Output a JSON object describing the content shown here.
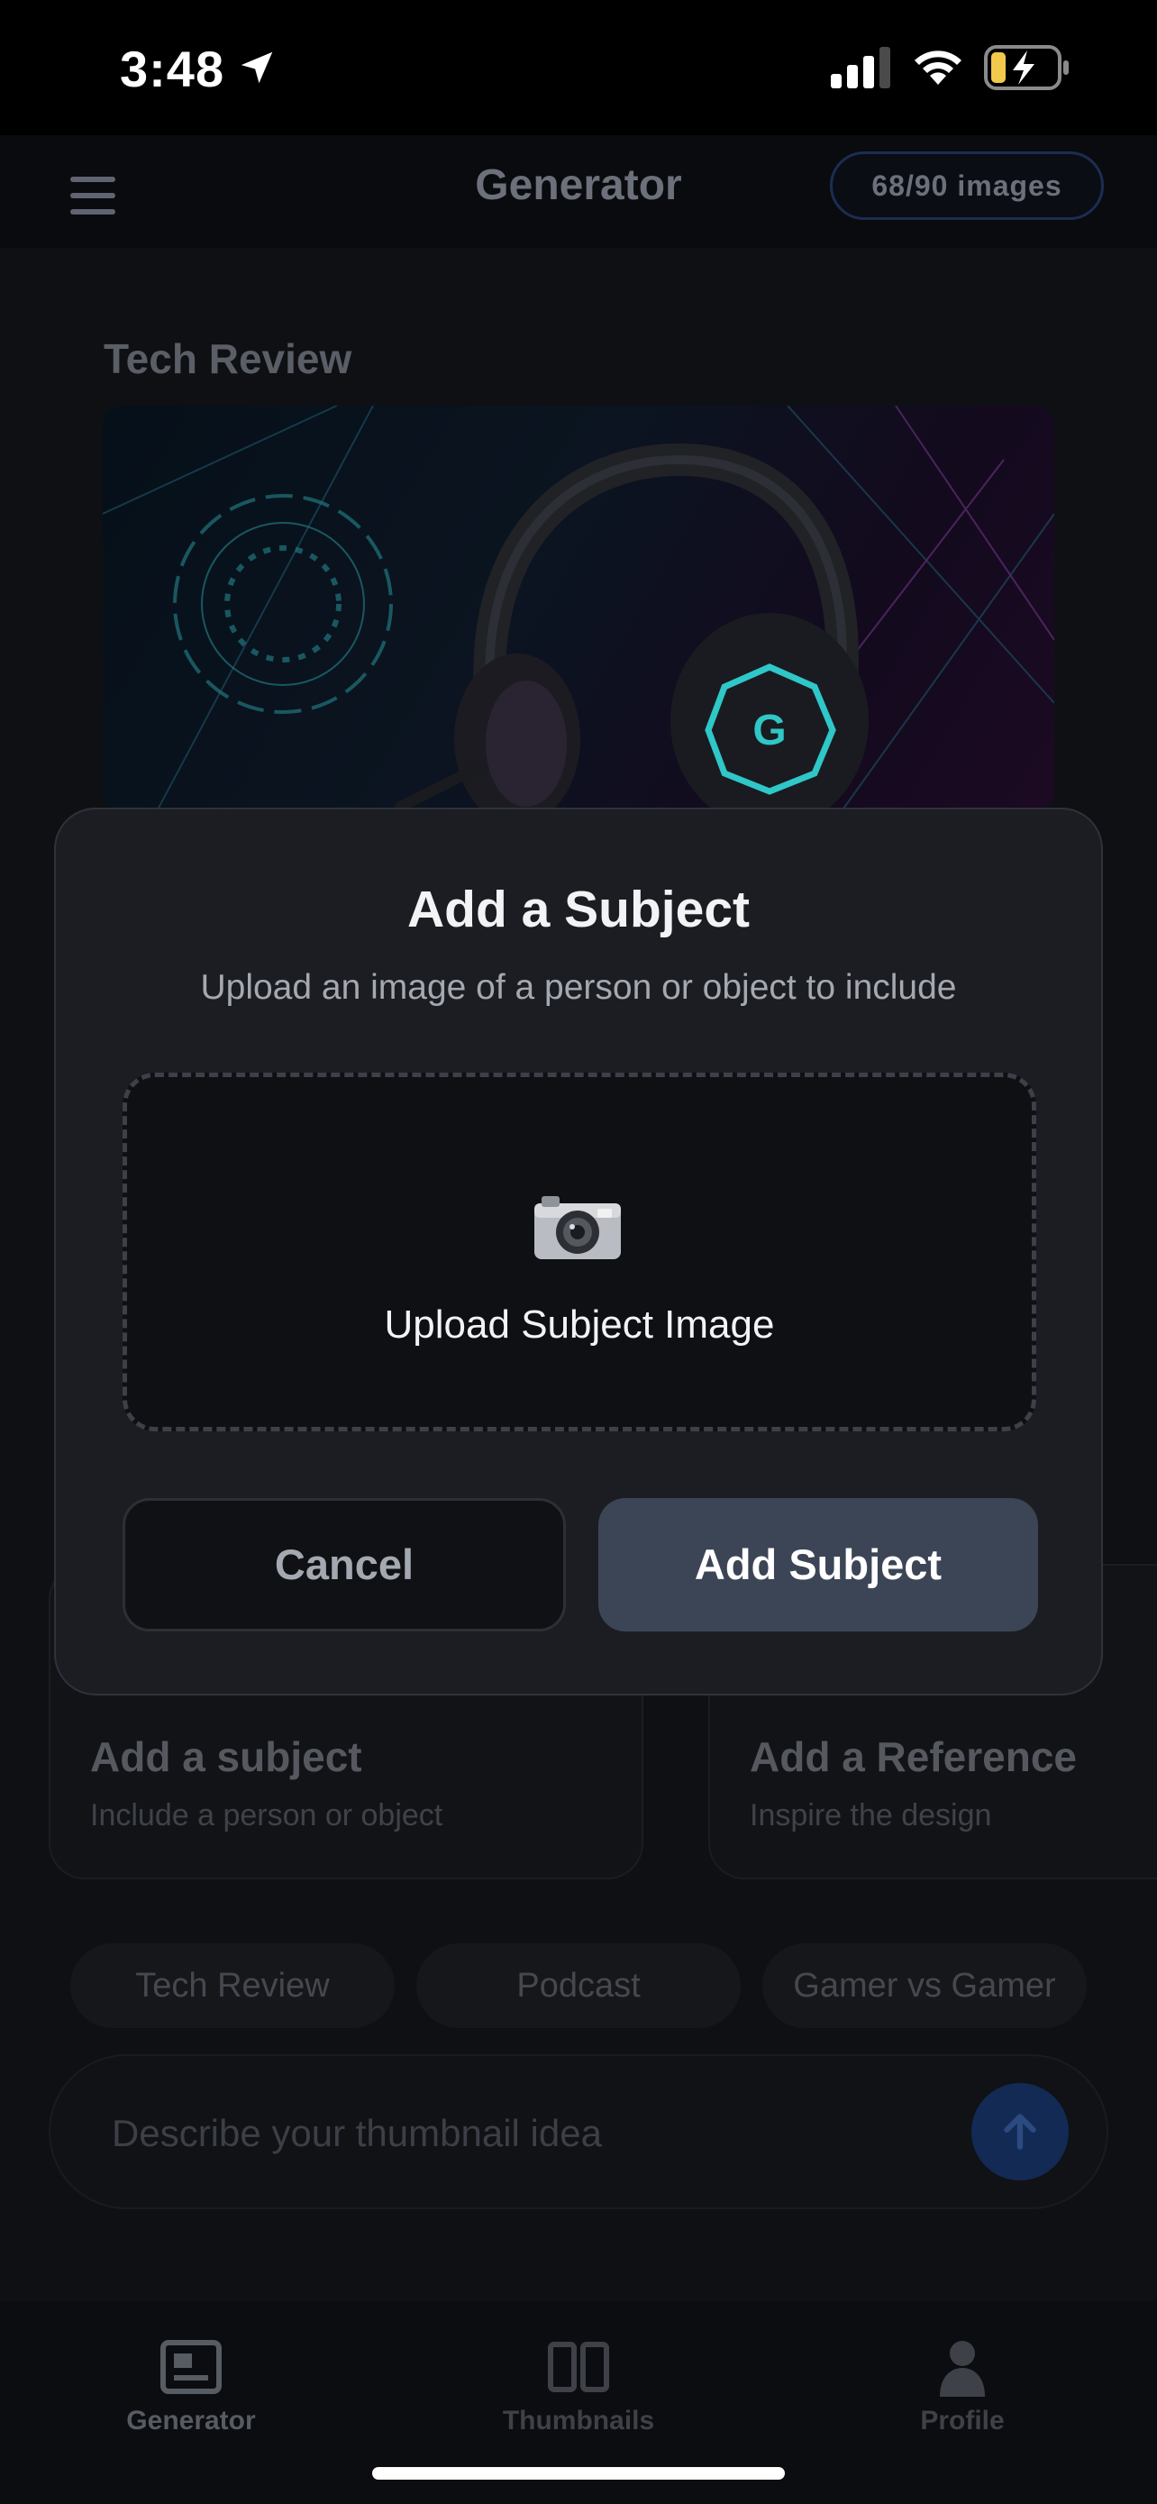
{
  "status_bar": {
    "time": "3:48"
  },
  "header": {
    "title": "Generator",
    "quota": "68/90 images"
  },
  "main": {
    "template_title": "Tech Review",
    "options": [
      {
        "title": "Add a subject",
        "subtitle": "Include a person or object"
      },
      {
        "title": "Add a Reference",
        "subtitle": "Inspire the design"
      }
    ],
    "chips": [
      "Tech Review",
      "Podcast",
      "Gamer vs Gamer"
    ],
    "prompt": {
      "placeholder": "Describe your thumbnail idea"
    }
  },
  "modal": {
    "title": "Add a Subject",
    "subtitle": "Upload an image of a person or object to include",
    "upload_label": "Upload Subject Image",
    "cancel_label": "Cancel",
    "confirm_label": "Add Subject"
  },
  "tab_bar": {
    "items": [
      {
        "label": "Generator",
        "icon": "image-icon",
        "active": true
      },
      {
        "label": "Thumbnails",
        "icon": "columns-icon",
        "active": false
      },
      {
        "label": "Profile",
        "icon": "person-icon",
        "active": false
      }
    ]
  },
  "colors": {
    "background": "#0f1013",
    "modal": "#1b1d22",
    "primary_button": "#3c4556",
    "accent_blue": "#132a55",
    "battery_fill": "#f2c94c"
  }
}
